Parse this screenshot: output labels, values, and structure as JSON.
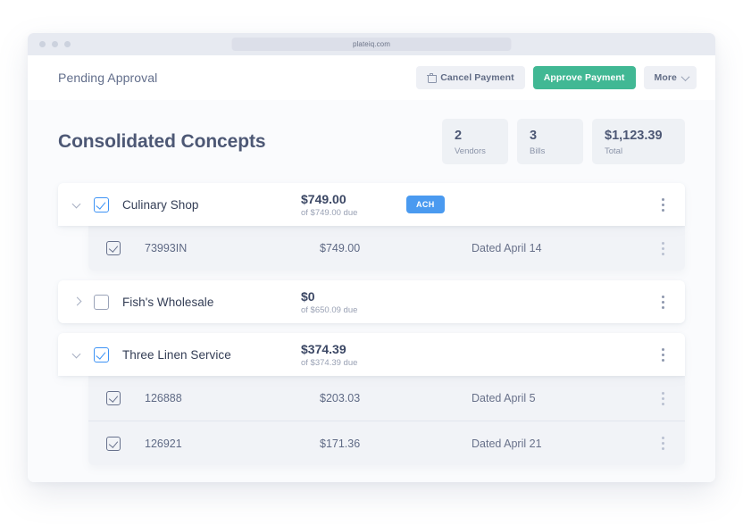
{
  "browser": {
    "url": "plateiq.com",
    "traffic_lights": 3
  },
  "header": {
    "status": "Pending Approval",
    "cancel_label": "Cancel Payment",
    "approve_label": "Approve Payment",
    "more_label": "More",
    "icons": {
      "trash": "trash-icon",
      "chevron": "chevron-down-icon"
    },
    "colors": {
      "approve_bg": "#41b894",
      "secondary_bg": "#eef0f5"
    }
  },
  "page": {
    "title": "Consolidated Concepts",
    "stats": [
      {
        "value": "2",
        "label": "Vendors"
      },
      {
        "value": "3",
        "label": "Bills"
      },
      {
        "value": "$1,123.39",
        "label": "Total"
      }
    ]
  },
  "groups": [
    {
      "name": "Culinary Shop",
      "amount": "$749.00",
      "due": "of $749.00 due",
      "badge": "ACH",
      "badge_color": "#4a9af0",
      "checked": true,
      "expanded": true,
      "bills": [
        {
          "number": "73993IN",
          "amount": "$749.00",
          "date": "Dated April 14",
          "checked": true
        }
      ]
    },
    {
      "name": "Fish's Wholesale",
      "amount": "$0",
      "due": "of $650.09 due",
      "badge": "",
      "checked": false,
      "expanded": false,
      "bills": []
    },
    {
      "name": "Three Linen Service",
      "amount": "$374.39",
      "due": "of $374.39 due",
      "badge": "",
      "checked": true,
      "expanded": true,
      "bills": [
        {
          "number": "126888",
          "amount": "$203.03",
          "date": "Dated April 5",
          "checked": true
        },
        {
          "number": "126921",
          "amount": "$171.36",
          "date": "Dated April 21",
          "checked": true
        }
      ]
    }
  ]
}
